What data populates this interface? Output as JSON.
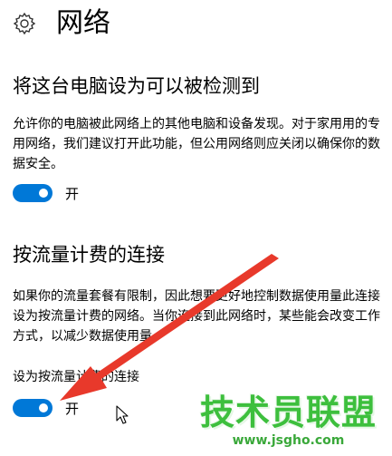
{
  "page": {
    "title": "网络",
    "icon": "gear-icon"
  },
  "discovery": {
    "heading": "将这台电脑设为可以被检测到",
    "description": "允许你的电脑被此网络上的其他电脑和设备发现。对于家用用的专用网络，我们建议打开此功能，但公用网络则应关闭以确保你的数据安全。",
    "toggle_state": "开",
    "toggle_on": true
  },
  "metered": {
    "heading": "按流量计费的连接",
    "description": "如果你的流量套餐有限制，因此想要更好地控制数据使用量此连接设为按流量计费的网络。当你连接到此网络时，某些能会改变工作方式，以减少数据使用量。",
    "setting_label": "设为按流量计费的连接",
    "toggle_state": "开",
    "toggle_on": true
  },
  "watermark": {
    "text": "技术员联盟",
    "url": "www.jsgho.com"
  },
  "colors": {
    "accent": "#0078d7",
    "arrow": "#e8392b",
    "watermark": "#3dbf3d"
  }
}
